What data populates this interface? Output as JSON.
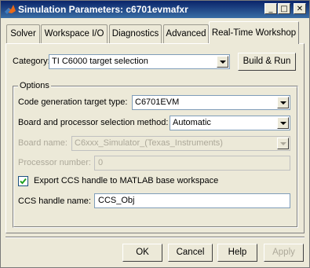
{
  "window": {
    "title": "Simulation Parameters: c6701evmafxr"
  },
  "title_controls": {
    "minimize": "_",
    "maximize": "□",
    "close": "✕"
  },
  "tabs": [
    {
      "label": "Solver"
    },
    {
      "label": "Workspace I/O"
    },
    {
      "label": "Diagnostics"
    },
    {
      "label": "Advanced"
    },
    {
      "label": "Real-Time Workshop"
    }
  ],
  "category": {
    "label": "Category:",
    "value": "TI C6000 target selection"
  },
  "build_button": "Build & Run",
  "options": {
    "title": "Options",
    "target_type": {
      "label": "Code generation target type:",
      "value": "C6701EVM"
    },
    "selection_method": {
      "label": "Board and processor selection method:",
      "value": "Automatic"
    },
    "board_name": {
      "label": "Board name:",
      "value": "C6xxx_Simulator_(Texas_Instruments)"
    },
    "processor_number": {
      "label": "Processor number:",
      "value": "0"
    },
    "export_ccs": {
      "label": "Export CCS handle to MATLAB base workspace",
      "checked": true
    },
    "ccs_handle": {
      "label": "CCS handle name:",
      "value": "CCS_Obj"
    }
  },
  "buttons": {
    "ok": "OK",
    "cancel": "Cancel",
    "help": "Help",
    "apply": "Apply"
  },
  "colors": {
    "titlebar": "#0a246a",
    "dialog": "#ece9d8",
    "disabled_text": "#aca899"
  }
}
